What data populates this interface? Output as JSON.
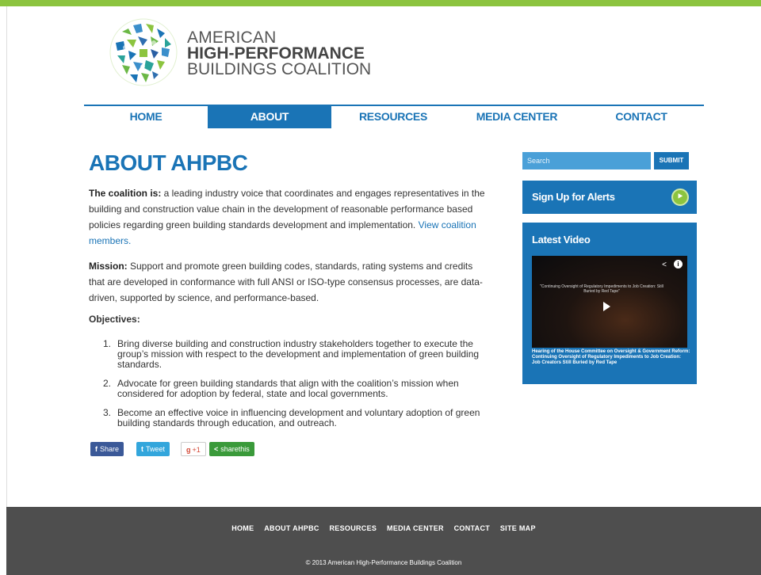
{
  "brand": {
    "line1": "AMERICAN",
    "line2": "HIGH-PERFORMANCE",
    "line3": "BUILDINGS COALITION",
    "logo_icon": "mosaic-leaf-logo-icon",
    "accent_color": "#1a74b6",
    "green_color": "#8cc43f"
  },
  "nav": {
    "items": [
      {
        "label": "HOME"
      },
      {
        "label": "ABOUT"
      },
      {
        "label": "RESOURCES"
      },
      {
        "label": "MEDIA CENTER"
      },
      {
        "label": "CONTACT"
      }
    ],
    "active": "ABOUT"
  },
  "main": {
    "title": "ABOUT AHPBC",
    "coalition_label": "The coalition is:",
    "coalition_text": " a leading industry voice that coordinates and engages representatives in the building and construction value chain in the development of reasonable performance based policies regarding green building standards development and implementation.",
    "coalition_link": "View coalition members.",
    "mission_label": "Mission:",
    "mission_text": " Support and promote green building codes, standards, rating systems and credits that are developed in conformance with full ANSI or ISO-type consensus processes, are data-driven, supported by science, and performance-based.",
    "objectives_title": "Objectives:",
    "objectives": [
      {
        "num": "1.",
        "text": "Bring diverse building and construction industry stakeholders together to execute the group’s mission with respect to the development and implementation of green building standards."
      },
      {
        "num": "2.",
        "text": "Advocate for green building standards that align with the coalition’s mission when considered for adoption by federal, state and local governments."
      },
      {
        "num": "3.",
        "text": "Become an effective voice in influencing development and voluntary adoption of green building standards through education, and outreach."
      }
    ]
  },
  "share": {
    "facebook": "Share",
    "twitter": "Tweet",
    "google": "+1",
    "sharethis": "sharethis",
    "facebook_icon": "f",
    "twitter_icon": "t",
    "google_icon": "g",
    "sharethis_icon": "<"
  },
  "sidebar": {
    "search_placeholder": "Search",
    "search_button": "SUBMIT",
    "alerts_label": "Sign Up for Alerts",
    "video_title": "Latest Video",
    "video_overlay": "\"Continuing Oversight of Regulatory Impediments to Job Creation: Still Buried by Red Tape\"",
    "video_caption": "Hearing of the House Committee on Oversight & Government Reform: Continuing Oversight of Regulatory Impediments to Job Creation: Job Creators Still Buried by Red Tape",
    "video_info": "i"
  },
  "footer": {
    "links": [
      "HOME",
      "ABOUT AHPBC",
      "RESOURCES",
      "MEDIA CENTER",
      "CONTACT",
      "SITE MAP"
    ],
    "copyright": "© 2013 American High-Performance Buildings Coalition"
  }
}
